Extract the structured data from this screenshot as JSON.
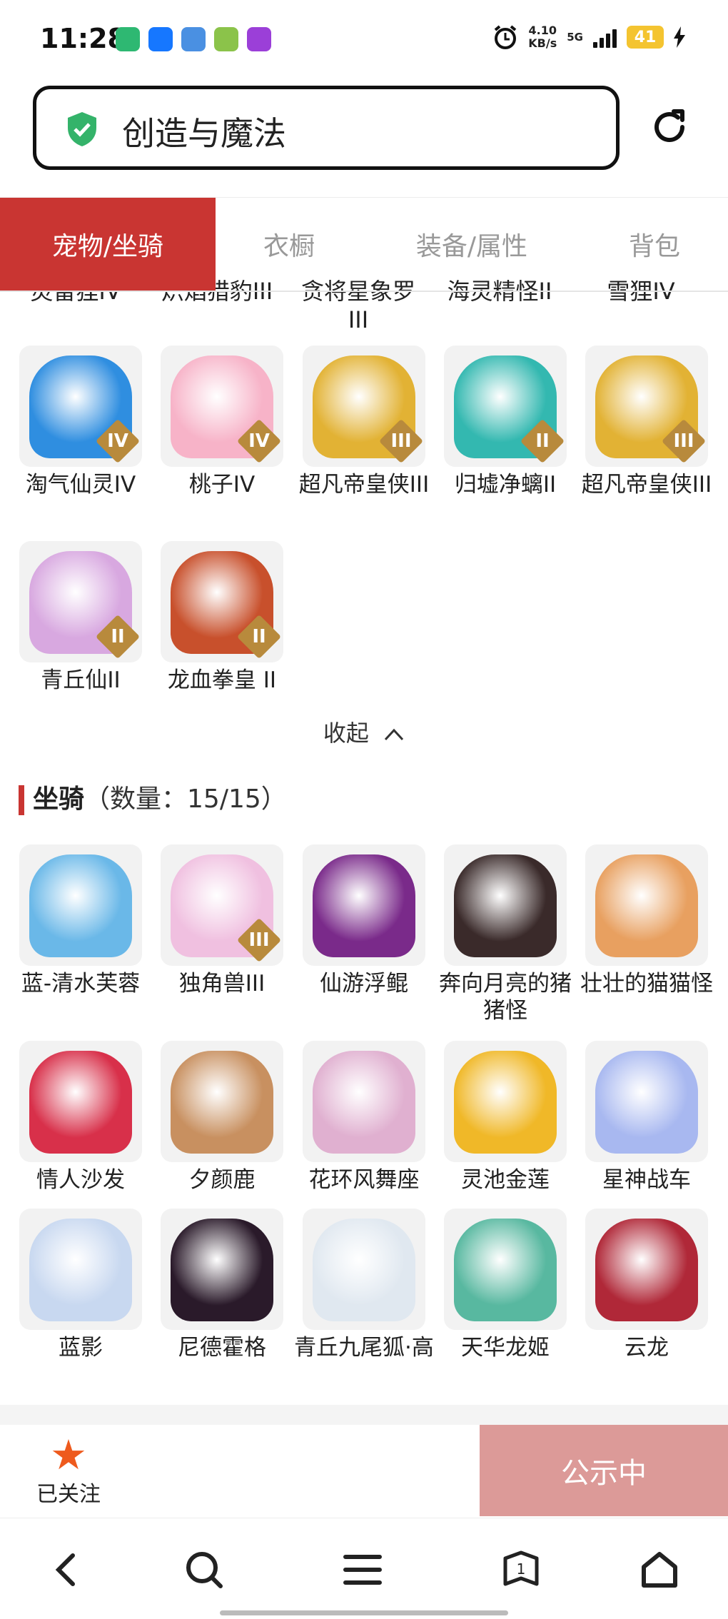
{
  "status": {
    "time": "11:28",
    "speed_value": "4.10",
    "speed_unit": "KB/s",
    "network": "5G",
    "battery": "41"
  },
  "search": {
    "text": "创造与魔法"
  },
  "tabs": [
    "宠物/坐骑",
    "衣橱",
    "装备/属性",
    "背包"
  ],
  "peek_labels": [
    "灵雷狸IV",
    "炽焰猎豹III",
    "贪将星象罗III",
    "海灵精怪II",
    "雪狸IV"
  ],
  "pets": [
    {
      "label": "淘气仙灵IV",
      "badge": "IV",
      "color": "#2f8ee0"
    },
    {
      "label": "桃子IV",
      "badge": "IV",
      "color": "#f7b3c8"
    },
    {
      "label": "超凡帝皇侠III",
      "badge": "III",
      "color": "#e2b234"
    },
    {
      "label": "归墟净螭II",
      "badge": "II",
      "color": "#33b8b0"
    },
    {
      "label": "超凡帝皇侠III",
      "badge": "III",
      "color": "#e2b234"
    },
    {
      "label": "青丘仙II",
      "badge": "II",
      "color": "#d8a8e0"
    },
    {
      "label": "龙血拳皇 II",
      "badge": "II",
      "color": "#c8502c"
    }
  ],
  "collapse": "收起",
  "mounts_section": {
    "title": "坐骑",
    "count": "（数量：15/15）"
  },
  "mounts": [
    {
      "label": "蓝-清水芙蓉",
      "color": "#6ab8e8"
    },
    {
      "label": "独角兽III",
      "badge": "III",
      "color": "#f0c0e0"
    },
    {
      "label": "仙游浮鲲",
      "color": "#7a2a8a"
    },
    {
      "label": "奔向月亮的猪猪怪",
      "color": "#3a2a2a"
    },
    {
      "label": "壮壮的猫猫怪",
      "color": "#e8a060"
    },
    {
      "label": "情人沙发",
      "color": "#d8304a"
    },
    {
      "label": "夕颜鹿",
      "color": "#c89060"
    },
    {
      "label": "花环风舞座",
      "color": "#e0b0d0"
    },
    {
      "label": "灵池金莲",
      "color": "#f0b828"
    },
    {
      "label": "星神战车",
      "color": "#a8b8f0"
    },
    {
      "label": "蓝影",
      "color": "#c8d8f0"
    },
    {
      "label": "尼德霍格",
      "color": "#2a1a2a"
    },
    {
      "label": "青丘九尾狐·高",
      "color": "#e0e8f0"
    },
    {
      "label": "天华龙姬",
      "color": "#58b8a0"
    },
    {
      "label": "云龙",
      "color": "#b02838"
    }
  ],
  "actions": {
    "follow": "已关注",
    "publish": "公示中"
  },
  "nav": {
    "tab_count": "1"
  },
  "colors": {
    "accent": "#c93532",
    "publish_bg": "#dc9a98",
    "star": "#ee5a1d"
  }
}
